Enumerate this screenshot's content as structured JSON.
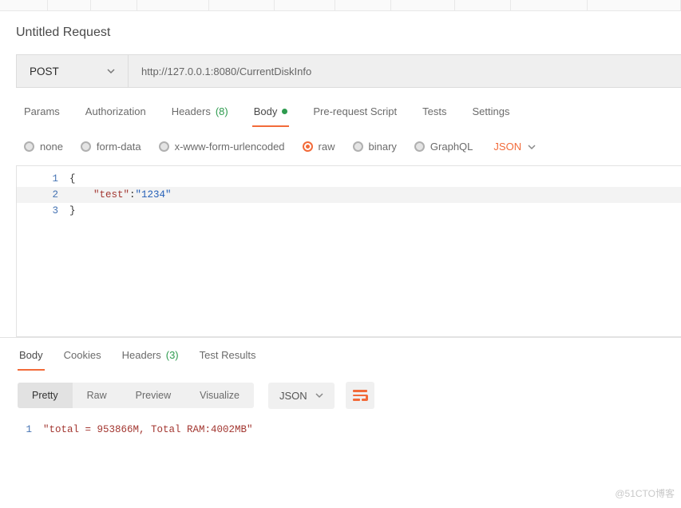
{
  "title": "Untitled Request",
  "request": {
    "method": "POST",
    "url": "http://127.0.0.1:8080/CurrentDiskInfo"
  },
  "tabs": {
    "params": "Params",
    "authorization": "Authorization",
    "headers": "Headers",
    "headers_count": "(8)",
    "body": "Body",
    "prerequest": "Pre-request Script",
    "tests": "Tests",
    "settings": "Settings"
  },
  "body_types": {
    "none": "none",
    "formdata": "form-data",
    "urlencoded": "x-www-form-urlencoded",
    "raw": "raw",
    "binary": "binary",
    "graphql": "GraphQL",
    "lang": "JSON"
  },
  "request_body": {
    "line1_num": "1",
    "line1_text_open": "{",
    "line2_num": "2",
    "line2_key": "\"test\"",
    "line2_colon": ":",
    "line2_val": "\"1234\"",
    "line3_num": "3",
    "line3_text_close": "}"
  },
  "response": {
    "tabs": {
      "body": "Body",
      "cookies": "Cookies",
      "headers": "Headers",
      "headers_count": "(3)",
      "testresults": "Test Results"
    },
    "views": {
      "pretty": "Pretty",
      "raw": "Raw",
      "preview": "Preview",
      "visualize": "Visualize",
      "format": "JSON"
    },
    "body": {
      "line1_num": "1",
      "line1_text": "\"total = 953866M, Total RAM:4002MB\""
    }
  },
  "watermark": "@51CTO博客"
}
